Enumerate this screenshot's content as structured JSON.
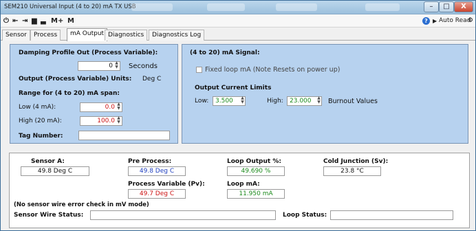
{
  "window": {
    "title": "SEM210 Universal Input (4 to 20) mA TX USB",
    "min": "–",
    "max": "□",
    "close": "X"
  },
  "toolbar": {
    "power": "⏻",
    "back": "⇤",
    "forward": "⇥",
    "save": "▆",
    "open": "▃",
    "mplus": "M+",
    "m": "M",
    "help": "?",
    "auto_read": "Auto Read",
    "play": "▶",
    "extra": "⚙"
  },
  "tabs": [
    "Sensor",
    "Process",
    "mA Output",
    "Diagnostics",
    "Diagnostics Log"
  ],
  "left_panel": {
    "damping_label": "Damping Profile Out (Process Variable):",
    "damping_value": "0",
    "damping_unit": "Seconds",
    "units_label": "Output (Process Variable) Units:",
    "units_value": "Deg C",
    "range_label": "Range for (4 to 20) mA span:",
    "low_label": "Low  (4 mA):",
    "low_value": "0.0",
    "high_label": "High (20 mA):",
    "high_value": "100.0",
    "tag_label": "Tag Number:",
    "tag_value": ""
  },
  "right_panel": {
    "signal_label": "(4 to 20) mA Signal:",
    "fixed_label": "Fixed loop mA  (Note Resets on power up)",
    "limits_label": "Output Current Limits",
    "low_label": "Low:",
    "low_value": "3.500",
    "high_label": "High:",
    "high_value": "23.000",
    "burnout_label": "Burnout Values"
  },
  "readings": {
    "sensor_a_label": "Sensor A:",
    "sensor_a_value": "49.8 Deg C",
    "pre_label": "Pre Process:",
    "pre_value": "49.8 Deg C",
    "loop_pct_label": "Loop Output %:",
    "loop_pct_value": "49.690 %",
    "cold_label": "Cold Junction (Sv):",
    "cold_value": "23.8 °C",
    "pv_label": "Process Variable (Pv):",
    "pv_value": "49.7 Deg C",
    "loop_ma_label": "Loop mA:",
    "loop_ma_value": "11.950 mA",
    "note": "(No sensor wire error check in mV mode)",
    "wire_label": "Sensor Wire Status:",
    "wire_value": "",
    "loop_status_label": "Loop Status:",
    "loop_status_value": ""
  },
  "colors": {
    "blue_value": "#1f3fbf",
    "red_value": "#cc1111",
    "green_value": "#1b8a1b"
  }
}
